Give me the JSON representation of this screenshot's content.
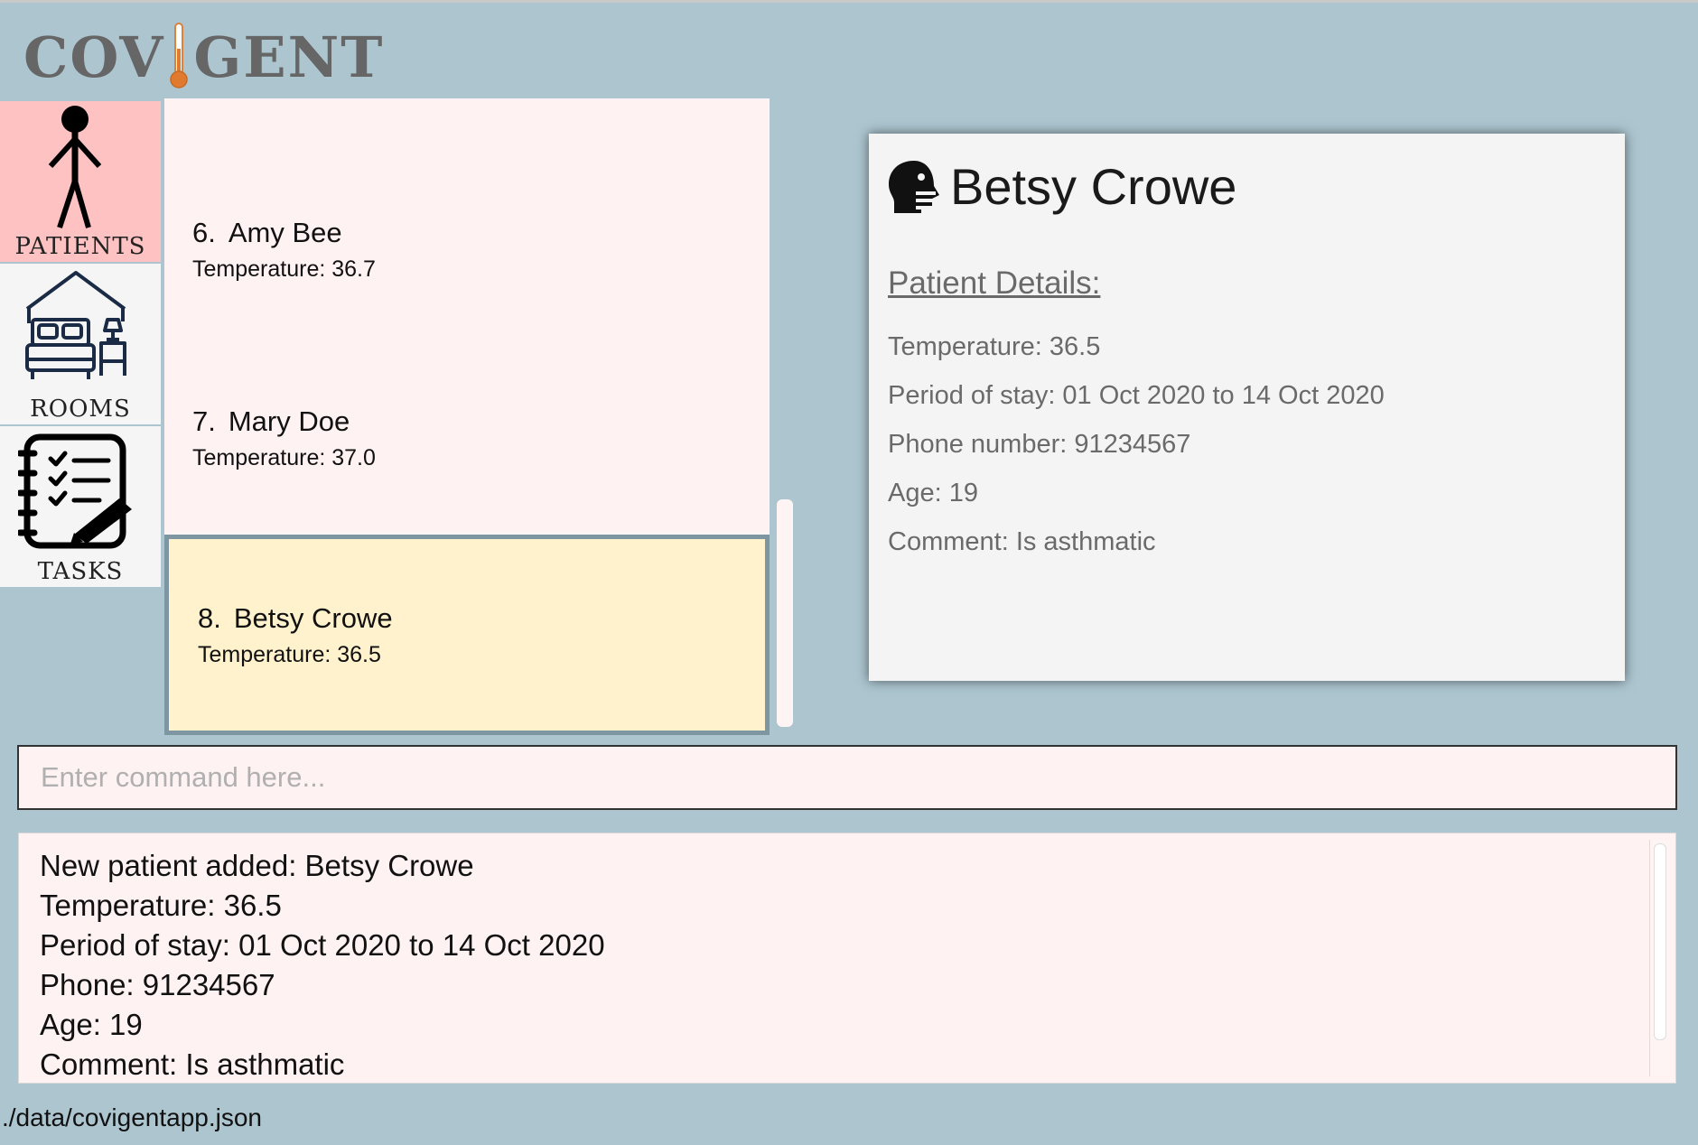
{
  "app": {
    "logo": {
      "left": "COV",
      "right": "GENT"
    }
  },
  "nav": {
    "patients_label": "PATIENTS",
    "rooms_label": "ROOMS",
    "tasks_label": "TASKS",
    "active": "patients",
    "active_color": "#ffc2c2"
  },
  "patient_list": {
    "items": [
      {
        "index": "6.",
        "name": "Amy Bee",
        "temperature": "Temperature: 36.7"
      },
      {
        "index": "7.",
        "name": "Mary Doe",
        "temperature": "Temperature: 37.0"
      },
      {
        "index": "8.",
        "name": "Betsy Crowe",
        "temperature": "Temperature: 36.5",
        "selected": true
      }
    ],
    "selected_color": "#fff2cc"
  },
  "detail": {
    "icon": "patient-head-icon",
    "name": "Betsy Crowe",
    "section_title": "Patient Details:",
    "temperature": "Temperature: 36.5",
    "period": "Period of stay: 01 Oct 2020 to 14 Oct 2020",
    "phone": "Phone number: 91234567",
    "age": "Age: 19",
    "comment": "Comment: Is asthmatic"
  },
  "command": {
    "placeholder": "Enter command here...",
    "value": ""
  },
  "result": {
    "lines": [
      "New patient added: Betsy Crowe",
      "Temperature: 36.5",
      "Period of stay: 01 Oct 2020 to 14 Oct 2020",
      "Phone: 91234567",
      "Age: 19",
      "Comment: Is asthmatic"
    ]
  },
  "status_bar": {
    "file_path": "./data/covigentapp.json"
  },
  "colors": {
    "background": "#acc5cf",
    "panel": "#fff2f2",
    "detail_card": "#f4f4f4"
  }
}
